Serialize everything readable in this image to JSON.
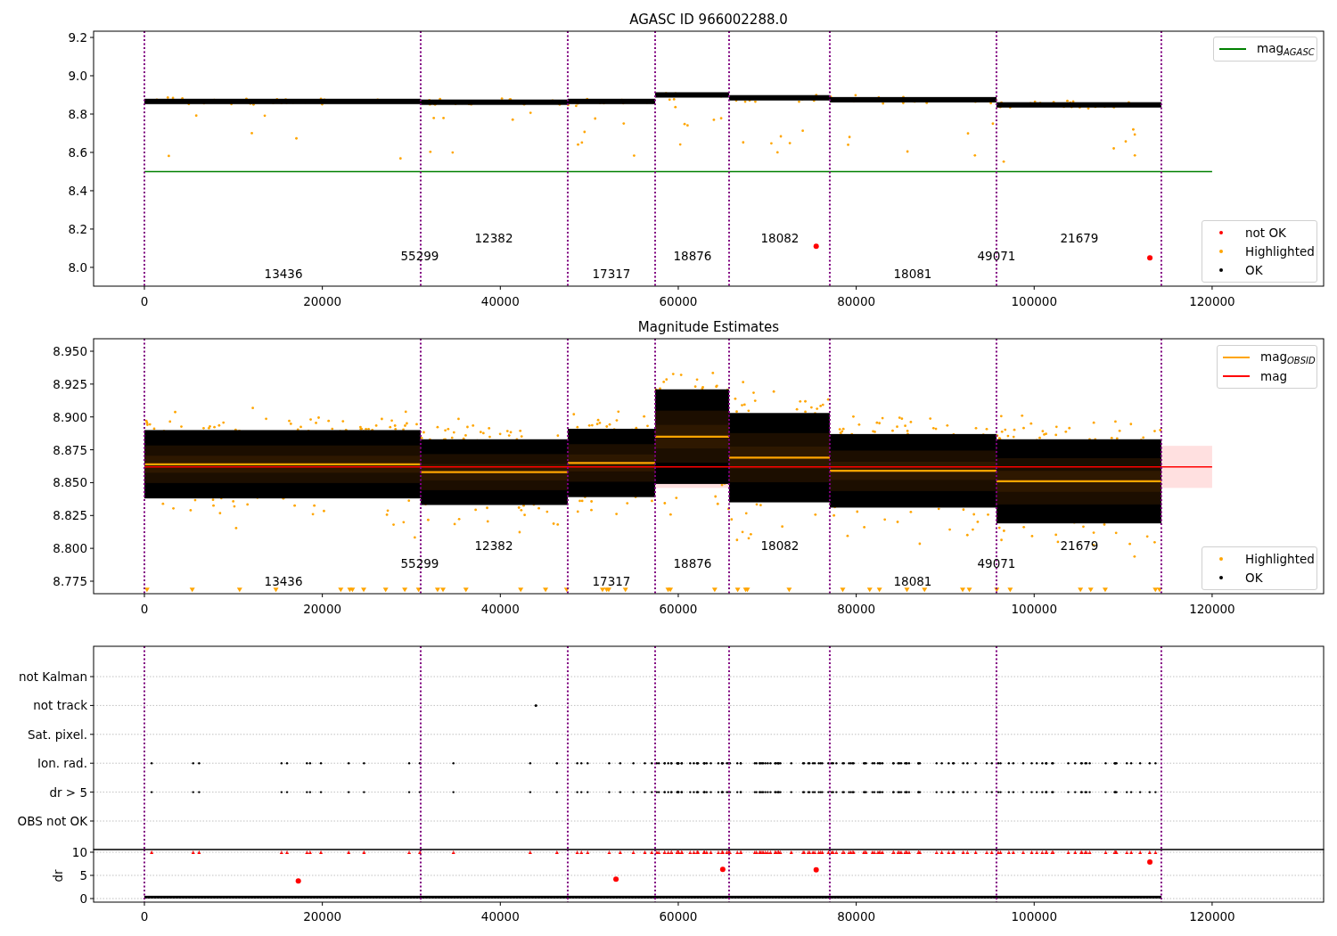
{
  "figure": {
    "panels": [
      {
        "chart_data": {
          "type": "scatter",
          "title": "AGASC ID 966002288.0",
          "xlim": [
            -5710,
            132530
          ],
          "ylim": [
            7.902,
            9.2326
          ],
          "xticks": [
            0,
            20000,
            40000,
            60000,
            80000,
            100000,
            120000
          ],
          "yticks": [
            {
              "value": 8.0,
              "label": "8.0"
            },
            {
              "value": 8.2,
              "label": "8.2"
            },
            {
              "value": 8.4,
              "label": "8.4"
            },
            {
              "value": 8.6,
              "label": "8.6"
            },
            {
              "value": 8.8,
              "label": "8.8"
            },
            {
              "value": 9.0,
              "label": "9.0"
            },
            {
              "value": 9.2,
              "label": "9.2"
            }
          ],
          "x": [
            75500,
            113000
          ],
          "series": [
            {
              "name": "not OK",
              "color": "#ff0000",
              "values": [
                8.11,
                8.05
              ]
            }
          ],
          "ref_lines": [
            {
              "axis": "y",
              "value": 8.5,
              "color": "#008000",
              "label": "mag$_{AGASC}$"
            },
            {
              "axis": "x",
              "value": 0,
              "color": "#800080"
            },
            {
              "axis": "x",
              "value": 31050,
              "color": "#800080"
            },
            {
              "axis": "x",
              "value": 47580,
              "color": "#800080"
            },
            {
              "axis": "x",
              "value": 57400,
              "color": "#800080"
            },
            {
              "axis": "x",
              "value": 65710,
              "color": "#800080"
            },
            {
              "axis": "x",
              "value": 77030,
              "color": "#800080"
            },
            {
              "axis": "x",
              "value": 95760,
              "color": "#800080"
            },
            {
              "axis": "x",
              "value": 114290,
              "color": "#800080"
            }
          ],
          "annotations": [
            "13436",
            "55299",
            "12382",
            "17317",
            "18876",
            "18082",
            "18081",
            "49071",
            "21679"
          ]
        },
        "point_legend": [
          {
            "label": "Highlighted",
            "color": "#ffa500"
          },
          {
            "label": "OK",
            "color": "#000000"
          }
        ]
      },
      {
        "chart_data": {
          "type": "line",
          "title": "Magnitude Estimates",
          "xlim": [
            -5710,
            132530
          ],
          "ylim": [
            8.7655,
            8.9595
          ],
          "xticks": [
            0,
            20000,
            40000,
            60000,
            80000,
            100000,
            120000
          ],
          "yticks": [
            {
              "value": 8.775,
              "label": "8.775"
            },
            {
              "value": 8.8,
              "label": "8.800"
            },
            {
              "value": 8.825,
              "label": "8.825"
            },
            {
              "value": 8.85,
              "label": "8.850"
            },
            {
              "value": 8.875,
              "label": "8.875"
            },
            {
              "value": 8.9,
              "label": "8.900"
            },
            {
              "value": 8.925,
              "label": "8.925"
            },
            {
              "value": 8.95,
              "label": "8.950"
            }
          ],
          "x": [
            0,
            31050,
            47580,
            57400,
            65710,
            77030,
            95760,
            114290
          ],
          "series": [
            {
              "name": "mag$_{OBSID}$",
              "color": "#ffa500",
              "values": [
                8.864,
                8.864,
                null,
                null,
                null,
                null,
                null,
                null
              ]
            },
            {
              "color": "#ffa500",
              "values": [
                null,
                8.858,
                8.858,
                null,
                null,
                null,
                null,
                null
              ]
            },
            {
              "color": "#ffa500",
              "values": [
                null,
                null,
                8.865,
                8.865,
                null,
                null,
                null,
                null
              ]
            },
            {
              "color": "#ffa500",
              "values": [
                null,
                null,
                null,
                8.885,
                8.885,
                null,
                null,
                null
              ]
            },
            {
              "color": "#ffa500",
              "values": [
                null,
                null,
                null,
                null,
                8.869,
                8.869,
                null,
                null
              ]
            },
            {
              "color": "#ffa500",
              "values": [
                null,
                null,
                null,
                null,
                null,
                8.859,
                8.859,
                null
              ]
            },
            {
              "color": "#ffa500",
              "values": [
                null,
                null,
                null,
                null,
                null,
                null,
                8.851,
                8.851
              ]
            }
          ],
          "ref_lines": [
            {
              "axis": "y",
              "value": 8.862,
              "color": "#ff0000",
              "label": "mag"
            },
            {
              "axis": "x",
              "value": 0,
              "color": "#800080"
            },
            {
              "axis": "x",
              "value": 31050,
              "color": "#800080"
            },
            {
              "axis": "x",
              "value": 47580,
              "color": "#800080"
            },
            {
              "axis": "x",
              "value": 57400,
              "color": "#800080"
            },
            {
              "axis": "x",
              "value": 65710,
              "color": "#800080"
            },
            {
              "axis": "x",
              "value": 77030,
              "color": "#800080"
            },
            {
              "axis": "x",
              "value": 95760,
              "color": "#800080"
            },
            {
              "axis": "x",
              "value": 114290,
              "color": "#800080"
            }
          ],
          "annotations": [
            "13436",
            "55299",
            "12382",
            "17317",
            "18876",
            "18082",
            "18081",
            "49071",
            "21679"
          ]
        },
        "point_legend": [
          {
            "label": "Highlighted",
            "color": "#ffa500"
          },
          {
            "label": "OK",
            "color": "#000000"
          }
        ]
      },
      {
        "row_labels": [
          "not Kalman",
          "not track",
          "Sat. pixel.",
          "Ion. rad.",
          "dr > 5",
          "OBS not OK"
        ]
      },
      {
        "chart_data": {
          "type": "scatter",
          "ylabel": "dr",
          "grid": true,
          "xlim": [
            -5710,
            132530
          ],
          "ylim": [
            -0.77,
            10.58
          ],
          "xticks": [
            0,
            20000,
            40000,
            60000,
            80000,
            100000,
            120000
          ],
          "yticks": [
            {
              "value": 0,
              "label": "0"
            },
            {
              "value": 5,
              "label": "5"
            },
            {
              "value": 10,
              "label": "10"
            }
          ],
          "x": [
            17300,
            53000,
            65000,
            75500,
            113000
          ],
          "series": [
            {
              "color": "#ff0000",
              "values": [
                3.8,
                4.2,
                6.3,
                6.2,
                7.9
              ]
            }
          ],
          "ref_lines": [
            {
              "axis": "x",
              "value": 0,
              "color": "#800080"
            },
            {
              "axis": "x",
              "value": 31050,
              "color": "#800080"
            },
            {
              "axis": "x",
              "value": 47580,
              "color": "#800080"
            },
            {
              "axis": "x",
              "value": 57400,
              "color": "#800080"
            },
            {
              "axis": "x",
              "value": 65710,
              "color": "#800080"
            },
            {
              "axis": "x",
              "value": 77030,
              "color": "#800080"
            },
            {
              "axis": "x",
              "value": 95760,
              "color": "#800080"
            },
            {
              "axis": "x",
              "value": 114290,
              "color": "#800080"
            }
          ]
        }
      }
    ]
  }
}
